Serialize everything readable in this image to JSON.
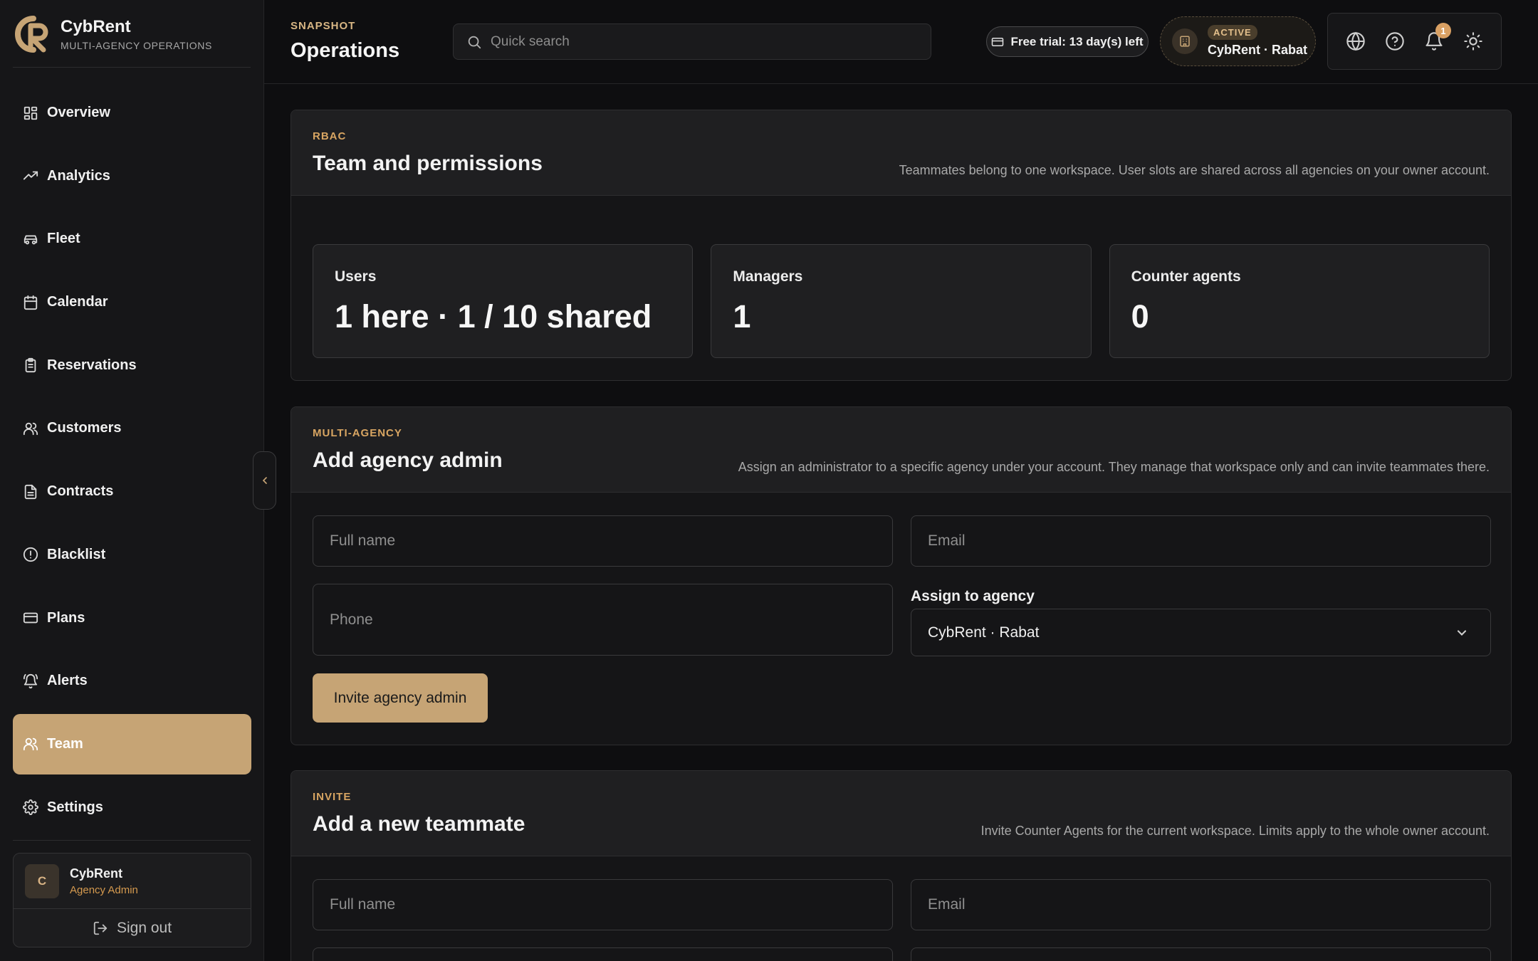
{
  "brand": {
    "name": "CybRent",
    "subtitle": "MULTI-AGENCY OPERATIONS"
  },
  "sidebar": {
    "items": [
      {
        "label": "Overview",
        "icon": "grid-icon"
      },
      {
        "label": "Analytics",
        "icon": "trending-up-icon"
      },
      {
        "label": "Fleet",
        "icon": "car-icon"
      },
      {
        "label": "Calendar",
        "icon": "calendar-icon"
      },
      {
        "label": "Reservations",
        "icon": "clipboard-icon"
      },
      {
        "label": "Customers",
        "icon": "users-icon"
      },
      {
        "label": "Contracts",
        "icon": "file-text-icon"
      },
      {
        "label": "Blacklist",
        "icon": "alert-circle-icon"
      },
      {
        "label": "Plans",
        "icon": "credit-card-icon"
      },
      {
        "label": "Alerts",
        "icon": "bell-ring-icon"
      },
      {
        "label": "Team",
        "icon": "users-icon",
        "active": true
      },
      {
        "label": "Settings",
        "icon": "gear-icon"
      }
    ],
    "user": {
      "initial": "C",
      "name": "CybRent",
      "role": "Agency Admin"
    },
    "signout_label": "Sign out"
  },
  "header": {
    "kicker": "SNAPSHOT",
    "title": "Operations",
    "search_placeholder": "Quick search",
    "trial_label": "Free trial: 13 day(s) left",
    "agency_status": "ACTIVE",
    "agency_name": "CybRent · Rabat",
    "notification_count": "1"
  },
  "team_card": {
    "kicker": "RBAC",
    "title": "Team and permissions",
    "description": "Teammates belong to one workspace. User slots are shared across all agencies on your owner account.",
    "stats": [
      {
        "label": "Users",
        "value": "1 here · 1 / 10 shared"
      },
      {
        "label": "Managers",
        "value": "1"
      },
      {
        "label": "Counter agents",
        "value": "0"
      }
    ]
  },
  "agency_admin_card": {
    "kicker": "MULTI-AGENCY",
    "title": "Add agency admin",
    "description": "Assign an administrator to a specific agency under your account. They manage that workspace only and can invite teammates there.",
    "fullname_placeholder": "Full name",
    "email_placeholder": "Email",
    "phone_placeholder": "Phone",
    "assign_label": "Assign to agency",
    "assign_value": "CybRent · Rabat",
    "invite_button": "Invite agency admin"
  },
  "invite_card": {
    "kicker": "INVITE",
    "title": "Add a new teammate",
    "description": "Invite Counter Agents for the current workspace. Limits apply to the whole owner account.",
    "fullname_placeholder": "Full name",
    "email_placeholder": "Email"
  },
  "colors": {
    "accent": "#c6a475",
    "kicker": "#d8a562",
    "background": "#0e0e10"
  }
}
